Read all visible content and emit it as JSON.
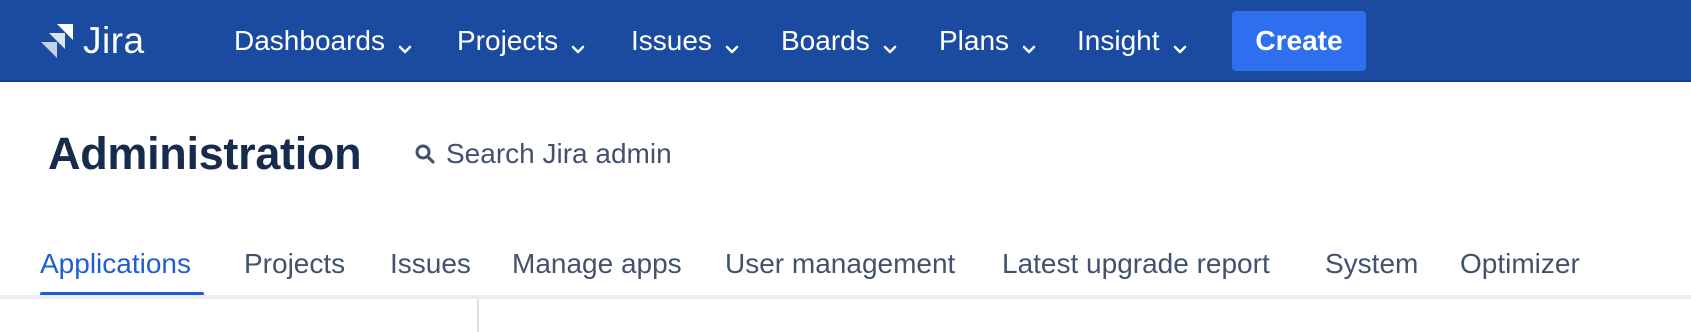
{
  "topnav": {
    "logo_text": "Jira",
    "items": [
      {
        "label": "Dashboards"
      },
      {
        "label": "Projects"
      },
      {
        "label": "Issues"
      },
      {
        "label": "Boards"
      },
      {
        "label": "Plans"
      },
      {
        "label": "Insight"
      }
    ],
    "create_label": "Create"
  },
  "header": {
    "title": "Administration",
    "search_label": "Search Jira admin"
  },
  "tabs": {
    "items": [
      {
        "label": "Applications",
        "active": true
      },
      {
        "label": "Projects",
        "active": false
      },
      {
        "label": "Issues",
        "active": false
      },
      {
        "label": "Manage apps",
        "active": false
      },
      {
        "label": "User management",
        "active": false
      },
      {
        "label": "Latest upgrade report",
        "active": false
      },
      {
        "label": "System",
        "active": false
      },
      {
        "label": "Optimizer",
        "active": false
      }
    ]
  },
  "colors": {
    "nav_background": "#1b4aa1",
    "create_button": "#2f6fef",
    "active_tab": "#1f5fd1",
    "text_primary": "#172b4d",
    "text_secondary": "#42526e"
  },
  "icons": {
    "logo": "jira-logo-icon",
    "chevron": "chevron-down-icon",
    "search": "search-icon"
  }
}
